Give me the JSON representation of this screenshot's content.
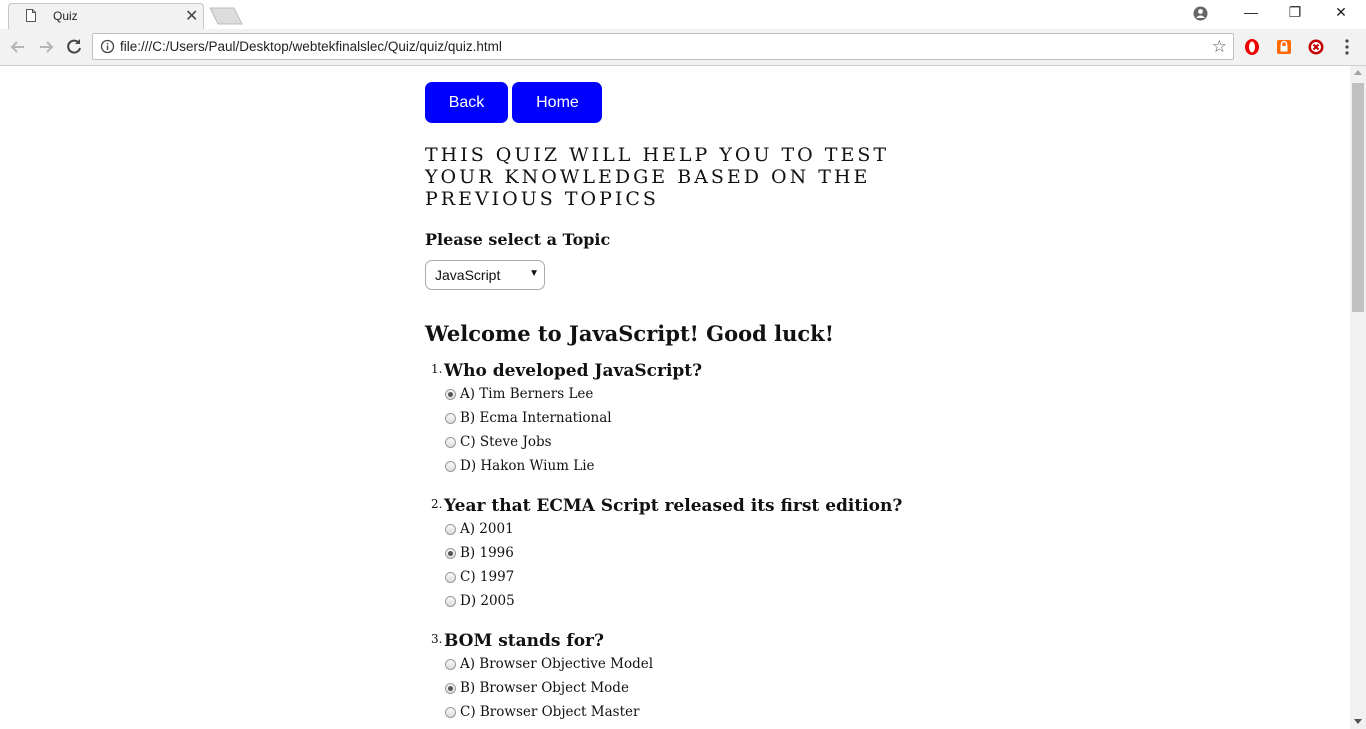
{
  "browser": {
    "tab_title": "Quiz",
    "tab_close": "✕",
    "url": "file:///C:/Users/Paul/Desktop/webtekfinalslec/Quiz/quiz/quiz.html",
    "window_controls": {
      "minimize": "—",
      "restore": "❐",
      "close": "✕"
    },
    "icons": [
      "document-icon",
      "new-tab-icon",
      "profile-icon",
      "back-icon",
      "forward-icon",
      "reload-icon",
      "info-icon",
      "star-icon",
      "opera-extension-icon",
      "lock-extension-icon",
      "block-extension-icon",
      "menu-icon"
    ]
  },
  "nav": {
    "back_label": "Back",
    "home_label": "Home"
  },
  "intro": "THIS QUIZ WILL HELP YOU TO TEST YOUR KNOWLEDGE BASED ON THE PREVIOUS TOPICS",
  "topic": {
    "label": "Please select a Topic",
    "selected": "JavaScript"
  },
  "welcome": "Welcome to JavaScript! Good luck!",
  "questions": [
    {
      "num": "1.",
      "text": "Who developed JavaScript?",
      "options": [
        {
          "text": "A) Tim Berners Lee",
          "checked": true
        },
        {
          "text": "B) Ecma International",
          "checked": false
        },
        {
          "text": "C) Steve Jobs",
          "checked": false
        },
        {
          "text": "D) Hakon Wium Lie",
          "checked": false
        }
      ]
    },
    {
      "num": "2.",
      "text": "Year that ECMA Script released its first edition?",
      "options": [
        {
          "text": "A) 2001",
          "checked": false
        },
        {
          "text": "B) 1996",
          "checked": true
        },
        {
          "text": "C) 1997",
          "checked": false
        },
        {
          "text": "D) 2005",
          "checked": false
        }
      ]
    },
    {
      "num": "3.",
      "text": "BOM stands for?",
      "options": [
        {
          "text": "A) Browser Objective Model",
          "checked": false
        },
        {
          "text": "B) Browser Object Mode",
          "checked": true
        },
        {
          "text": "C) Browser Object Master",
          "checked": false
        }
      ]
    }
  ],
  "colors": {
    "button_bg": "#0000ff",
    "button_text": "#ffffff"
  }
}
